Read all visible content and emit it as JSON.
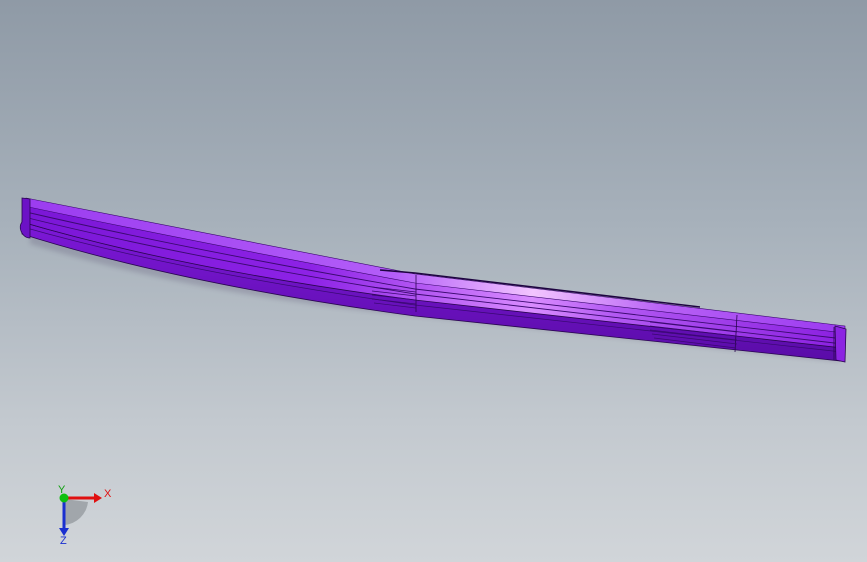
{
  "viewport": {
    "model": "curved-rail-part",
    "model_color": "#8a1fe0",
    "highlight_color": "#e7a6ff",
    "shadow_color": "#4a0a8a"
  },
  "triad": {
    "x_label": "X",
    "y_label": "Y",
    "z_label": "Z",
    "x_color": "#e01010",
    "y_color": "#10c010",
    "z_color": "#1a2fd0"
  }
}
